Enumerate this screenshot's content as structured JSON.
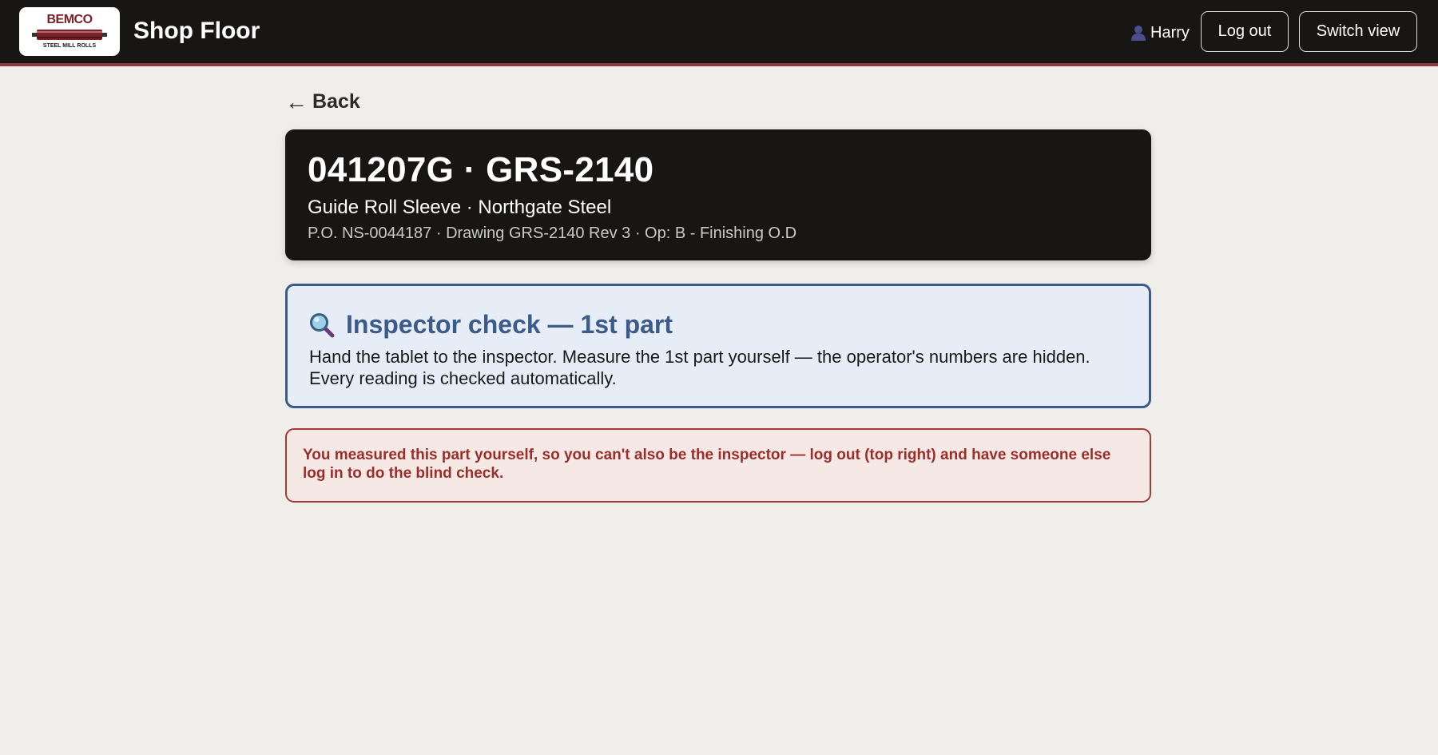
{
  "header": {
    "logo": {
      "top_text": "BEMCO",
      "bottom_text": "STEEL MILL ROLLS",
      "brand_color": "#7a2228"
    },
    "app_title": "Shop Floor",
    "user": {
      "icon": "user-icon",
      "name": "Harry"
    },
    "logout_label": "Log out",
    "switch_view_label": "Switch view",
    "accent_color": "#8b3a3e"
  },
  "back": {
    "arrow": "←",
    "label": "Back"
  },
  "job": {
    "title": "041207G · GRS-2140",
    "subtitle": "Guide Roll Sleeve · Northgate Steel",
    "meta": "P.O. NS-0044187 · Drawing GRS-2140 Rev 3 · Op: B - Finishing O.D"
  },
  "inspector": {
    "icon": "magnifier-icon",
    "title": "Inspector check — 1st part",
    "body": "Hand the tablet to the inspector. Measure the 1st part yourself — the operator's numbers are hidden. Every reading is checked automatically.",
    "color": "#3c5a8a"
  },
  "alert": {
    "message": "You measured this part yourself, so you can't also be the inspector — log out (top right) and have someone else log in to do the blind check.",
    "color": "#9b2e2a"
  }
}
